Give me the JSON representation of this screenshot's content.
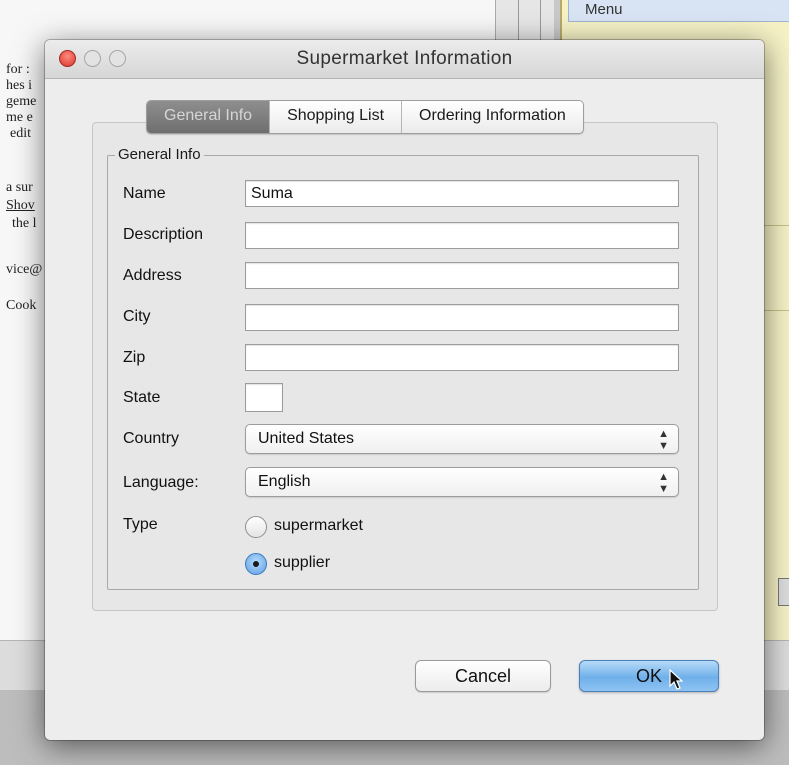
{
  "background": {
    "doc_lines": [
      "for :",
      "hes i",
      "geme",
      "me e",
      "edit",
      "a sur",
      "Shov",
      "the l",
      "vice@",
      "Cook"
    ],
    "menu_label": "Menu"
  },
  "dialog": {
    "title": "Supermarket Information",
    "tabs": [
      {
        "label": "General Info",
        "active": true
      },
      {
        "label": "Shopping List",
        "active": false
      },
      {
        "label": "Ordering Information",
        "active": false
      }
    ],
    "group_title": "General Info",
    "fields": {
      "name": {
        "label": "Name",
        "value": "Suma"
      },
      "description": {
        "label": "Description",
        "value": ""
      },
      "address": {
        "label": "Address",
        "value": ""
      },
      "city": {
        "label": "City",
        "value": ""
      },
      "zip": {
        "label": "Zip",
        "value": ""
      },
      "state": {
        "label": "State",
        "value": ""
      },
      "country": {
        "label": "Country",
        "value": "United States"
      },
      "language": {
        "label": "Language:",
        "value": "English"
      }
    },
    "type": {
      "label": "Type",
      "options": [
        {
          "label": "supermarket",
          "selected": false
        },
        {
          "label": "supplier",
          "selected": true
        }
      ]
    },
    "buttons": {
      "cancel": "Cancel",
      "ok": "OK"
    }
  },
  "colors": {
    "close_button": "#d8362b",
    "ok_button": "#6fb0ea",
    "active_tab": "#7a7a7a"
  },
  "icons": [
    "close-icon",
    "minimize-icon",
    "zoom-icon",
    "select-arrows-icon",
    "mouse-pointer-icon"
  ]
}
